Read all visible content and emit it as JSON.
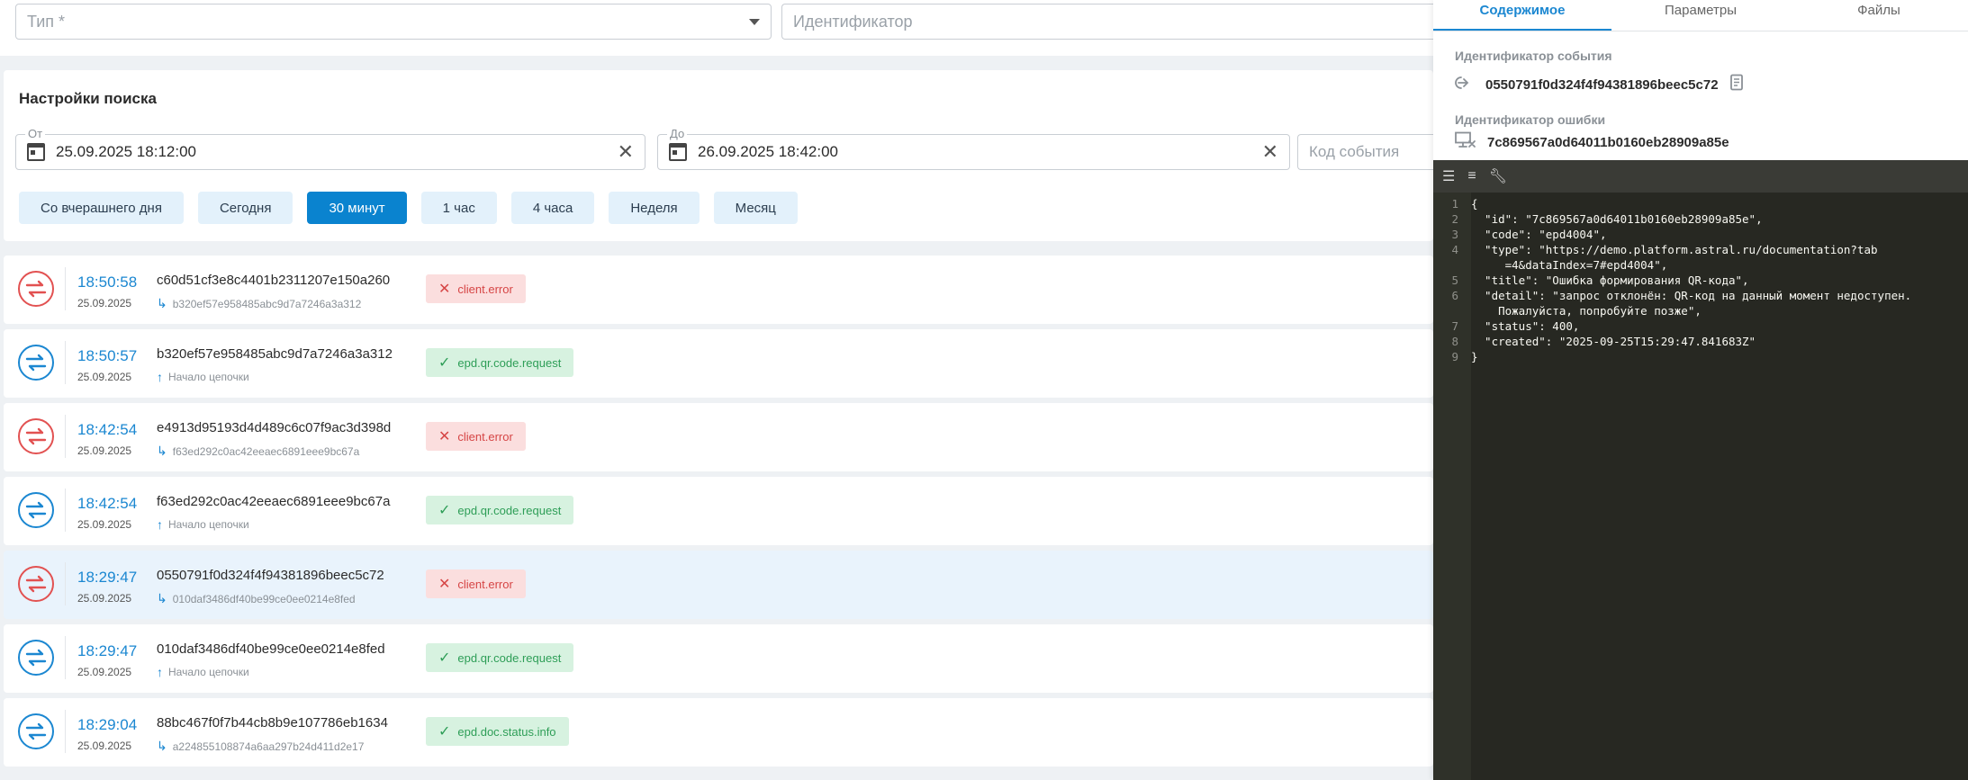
{
  "filters": {
    "type_placeholder": "Тип *",
    "identifier_placeholder": "Идентификатор"
  },
  "search": {
    "title": "Настройки поиска",
    "from_label": "От",
    "from_value": "25.09.2025 18:12:00",
    "to_label": "До",
    "to_value": "26.09.2025 18:42:00",
    "code_placeholder": "Код события",
    "chips": [
      "Со вчерашнего дня",
      "Сегодня",
      "30 минут",
      "1 час",
      "4 часа",
      "Неделя",
      "Месяц"
    ],
    "active_chip": "30 минут"
  },
  "events": [
    {
      "time": "18:50:58",
      "date": "25.09.2025",
      "id": "c60d51cf3e8c4401b2311207e150a260",
      "sub": "b320ef57e958485abc9d7a7246a3a312",
      "sub_kind": "child",
      "tag": "client.error",
      "status": "error",
      "direction": "out"
    },
    {
      "time": "18:50:57",
      "date": "25.09.2025",
      "id": "b320ef57e958485abc9d7a7246a3a312",
      "sub": "Начало цепочки",
      "sub_kind": "start",
      "tag": "epd.qr.code.request",
      "status": "ok",
      "direction": "in"
    },
    {
      "time": "18:42:54",
      "date": "25.09.2025",
      "id": "e4913d95193d4d489c6c07f9ac3d398d",
      "sub": "f63ed292c0ac42eeaec6891eee9bc67a",
      "sub_kind": "child",
      "tag": "client.error",
      "status": "error",
      "direction": "out"
    },
    {
      "time": "18:42:54",
      "date": "25.09.2025",
      "id": "f63ed292c0ac42eeaec6891eee9bc67a",
      "sub": "Начало цепочки",
      "sub_kind": "start",
      "tag": "epd.qr.code.request",
      "status": "ok",
      "direction": "in"
    },
    {
      "time": "18:29:47",
      "date": "25.09.2025",
      "id": "0550791f0d324f4f94381896beec5c72",
      "sub": "010daf3486df40be99ce0ee0214e8fed",
      "sub_kind": "child",
      "tag": "client.error",
      "status": "error",
      "direction": "out",
      "selected": true
    },
    {
      "time": "18:29:47",
      "date": "25.09.2025",
      "id": "010daf3486df40be99ce0ee0214e8fed",
      "sub": "Начало цепочки",
      "sub_kind": "start",
      "tag": "epd.qr.code.request",
      "status": "ok",
      "direction": "in"
    },
    {
      "time": "18:29:04",
      "date": "25.09.2025",
      "id": "88bc467f0f7b44cb8b9e107786eb1634",
      "sub": "a224855108874a6aa297b24d411d2e17",
      "sub_kind": "child",
      "tag": "epd.doc.status.info",
      "status": "ok",
      "direction": "in"
    }
  ],
  "panel": {
    "tabs": [
      "Содержимое",
      "Параметры",
      "Файлы"
    ],
    "active_tab": "Содержимое",
    "event_id_label": "Идентификатор события",
    "event_id": "0550791f0d324f4f94381896beec5c72",
    "error_id_label": "Идентификатор ошибки",
    "error_id": "7c869567a0d64011b0160eb28909a85e",
    "json_lines": [
      {
        "n": "1",
        "t": "{"
      },
      {
        "n": "2",
        "t": "  \"id\": \"7c869567a0d64011b0160eb28909a85e\","
      },
      {
        "n": "3",
        "t": "  \"code\": \"epd4004\","
      },
      {
        "n": "4",
        "t": "  \"type\": \"https://demo.platform.astral.ru/documentation?tab"
      },
      {
        "n": "",
        "t": "     =4&dataIndex=7#epd4004\","
      },
      {
        "n": "5",
        "t": "  \"title\": \"Ошибка формирования QR-кода\","
      },
      {
        "n": "6",
        "t": "  \"detail\": \"запрос отклонён: QR-код на данный момент недоступен."
      },
      {
        "n": "",
        "t": "    Пожалуйста, попробуйте позже\","
      },
      {
        "n": "7",
        "t": "  \"status\": 400,"
      },
      {
        "n": "8",
        "t": "  \"created\": \"2025-09-25T15:29:47.841683Z\""
      },
      {
        "n": "9",
        "t": "}"
      }
    ]
  },
  "colors": {
    "accent": "#1b87d1",
    "error": "#e25151",
    "ok": "#2e9e57",
    "editor_bg": "#272822"
  }
}
